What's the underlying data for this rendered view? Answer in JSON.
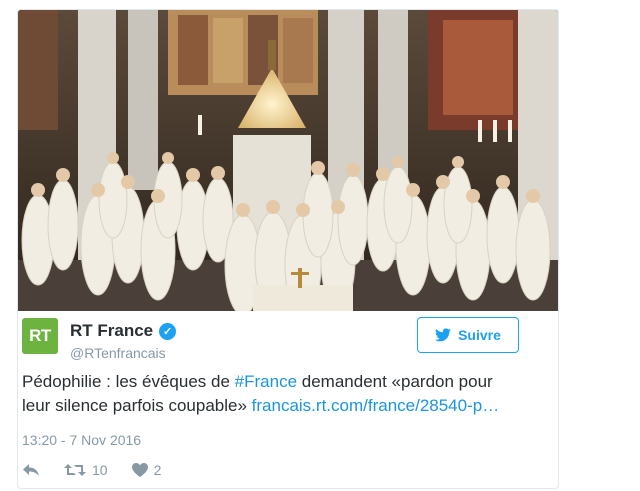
{
  "tweet": {
    "author_name": "RT France",
    "handle": "@RTenfrancais",
    "logo_text": "RT",
    "follow_label": "Suivre",
    "text_part1": "Pédophilie : les évêques de ",
    "hashtag": "#France",
    "text_part2": " demandent «pardon pour leur silence parfois coupable» ",
    "link_text": "francais.rt.com/france/28540-p…",
    "timestamp": "13:20 - 7 Nov 2016",
    "retweet_count": "10",
    "like_count": "2"
  },
  "colors": {
    "accent": "#1da1f2",
    "logo_green": "#6cb33f",
    "text": "#292f33",
    "muted": "#8899a6"
  },
  "icons": {
    "reply": "reply-icon",
    "retweet": "retweet-icon",
    "like": "heart-icon",
    "verified": "verified-icon",
    "bird": "twitter-bird-icon"
  }
}
